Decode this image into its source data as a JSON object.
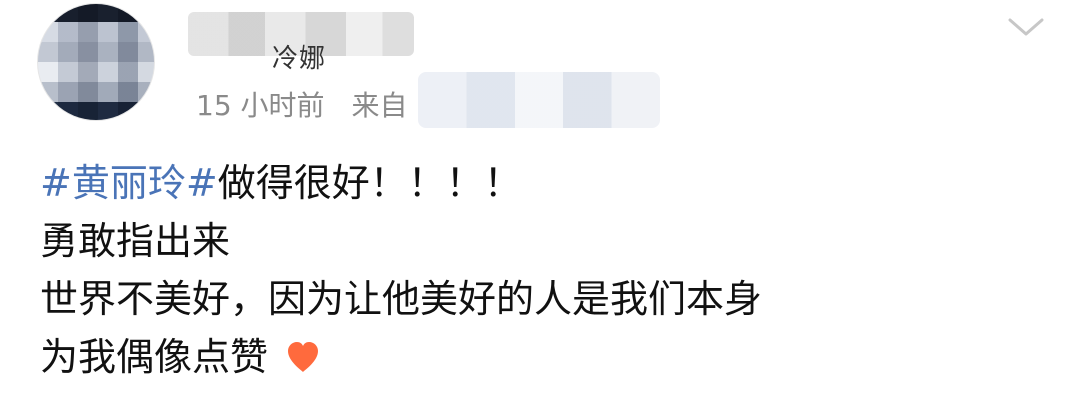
{
  "post": {
    "meta": {
      "time_ago": "15 小时前",
      "from_label": "来自",
      "name_partial": "冷娜"
    },
    "content": {
      "line1_topic": "#黄丽玲#",
      "line1_rest": "做得很好！！！！",
      "line2": "勇敢指出来",
      "line3": "世界不美好，因为让他美好的人是我们本身",
      "line4": "为我偶像点赞"
    },
    "icons": {
      "avatar": "avatar",
      "chevron": "chevron-down-icon",
      "heart": "heart-icon"
    },
    "colors": {
      "topic_blue": "#4a74b7",
      "meta_gray": "#8a8a8a",
      "heart_orange": "#ff6a3d"
    }
  }
}
